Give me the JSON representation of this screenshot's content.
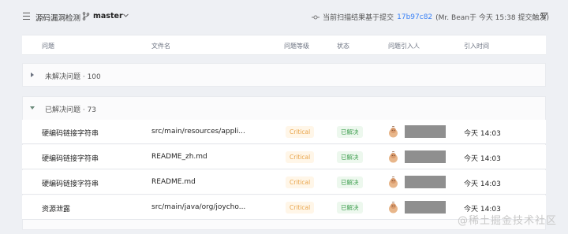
{
  "toolbar": {
    "title": "源码漏洞检测",
    "branch": "master",
    "scan_prefix": "当前扫描结果基于提交",
    "commit": "17b97c82",
    "scan_suffix": "(Mr. Bean于 今天 15:38 提交触发)"
  },
  "columns": [
    "问题",
    "文件名",
    "问题等级",
    "状态",
    "问题引入人",
    "引入时间"
  ],
  "groups": {
    "unresolved": "未解决问题 · 100",
    "resolved": "已解决问题 · 73"
  },
  "rows": [
    {
      "problem": "硬编码链接字符串",
      "file": "src/main/resources/appli...",
      "severity": "Critical",
      "status": "已解决",
      "time": "今天 14:03"
    },
    {
      "problem": "硬编码链接字符串",
      "file": "README_zh.md",
      "severity": "Critical",
      "status": "已解决",
      "time": "今天 14:03"
    },
    {
      "problem": "硬编码链接字符串",
      "file": "README.md",
      "severity": "Critical",
      "status": "已解决",
      "time": "今天 14:03"
    },
    {
      "problem": "资源泄露",
      "file": "src/main/java/org/joycho...",
      "severity": "Critical",
      "status": "已解决",
      "time": "今天 14:03"
    }
  ],
  "watermark": "@稀土掘金技术社区",
  "colors": {
    "accent": "#3b82f6",
    "critical": "#e8a44a",
    "resolved": "#3f9e4f"
  }
}
